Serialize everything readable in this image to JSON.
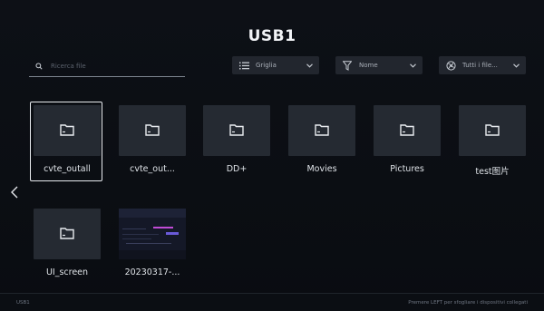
{
  "header": {
    "title": "USB1"
  },
  "search": {
    "placeholder": "Ricerca file",
    "value": "",
    "icon": "search-icon"
  },
  "toolbar": {
    "view": {
      "label": "Griglia",
      "icon": "list-icon"
    },
    "sort": {
      "label": "Nome",
      "icon": "filter-icon"
    },
    "filter": {
      "label": "Tutti i file...",
      "icon": "aperture-icon"
    }
  },
  "items": [
    {
      "name": "cvte_outall",
      "type": "folder",
      "selected": true
    },
    {
      "name": "cvte_out...",
      "type": "folder"
    },
    {
      "name": "DD+",
      "type": "folder"
    },
    {
      "name": "Movies",
      "type": "folder"
    },
    {
      "name": "Pictures",
      "type": "folder"
    },
    {
      "name": "test图片",
      "type": "folder"
    },
    {
      "name": "UI_screen",
      "type": "folder"
    },
    {
      "name": "20230317-...",
      "type": "image"
    }
  ],
  "statusbar": {
    "device": "USB1",
    "hint": "Premere LEFT per sfogliare i dispositivi collegati"
  },
  "colors": {
    "background": "#0a0d12",
    "tile": "#252a32",
    "dropdown": "#22262e",
    "selection_border": "#e8ebef",
    "text": "#dfe3e8",
    "thumbnail_accent": "#c04bd6"
  }
}
